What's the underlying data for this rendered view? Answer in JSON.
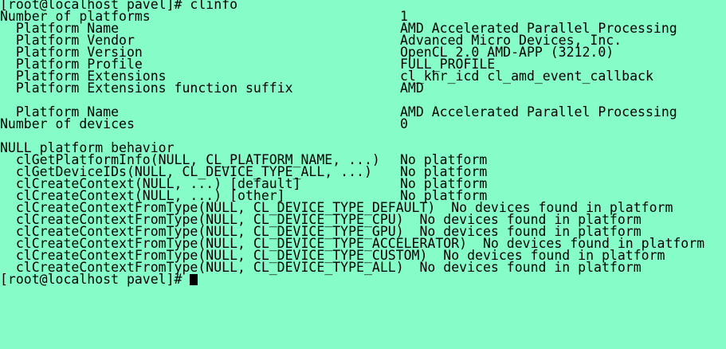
{
  "terminal": {
    "prompt": "[root@localhost pavel]# clinfo",
    "num_platforms": {
      "label": "Number of platforms",
      "value": "1"
    },
    "platform_name": {
      "label": "  Platform Name",
      "value": "AMD Accelerated Parallel Processing"
    },
    "platform_vendor": {
      "label": "  Platform Vendor",
      "value": "Advanced Micro Devices, Inc."
    },
    "platform_version": {
      "label": "  Platform Version",
      "value": "OpenCL 2.0 AMD-APP (3212.0)"
    },
    "platform_profile": {
      "label": "  Platform Profile",
      "value": "FULL_PROFILE"
    },
    "platform_extensions": {
      "label": "  Platform Extensions",
      "value": "cl_khr_icd cl_amd_event_callback"
    },
    "platform_ext_suffix": {
      "label": "  Platform Extensions function suffix",
      "value": "AMD"
    },
    "platform_name_2": {
      "label": "  Platform Name",
      "value": "AMD Accelerated Parallel Processing"
    },
    "num_devices": {
      "label": "Number of devices",
      "value": "0"
    },
    "null_behavior_header": "NULL platform behavior",
    "null_rows": [
      {
        "label": "  clGetPlatformInfo(NULL, CL_PLATFORM_NAME, ...)",
        "value": "No platform"
      },
      {
        "label": "  clGetDeviceIDs(NULL, CL_DEVICE_TYPE_ALL, ...)",
        "value": "No platform"
      },
      {
        "label": "  clCreateContext(NULL, ...) [default]",
        "value": "No platform"
      },
      {
        "label": "  clCreateContext(NULL, ...) [other]",
        "value": "No platform"
      }
    ],
    "ctx_from_type": [
      "  clCreateContextFromType(NULL, CL_DEVICE_TYPE_DEFAULT)  No devices found in platform",
      "  clCreateContextFromType(NULL, CL_DEVICE_TYPE_CPU)  No devices found in platform",
      "  clCreateContextFromType(NULL, CL_DEVICE_TYPE_GPU)  No devices found in platform",
      "  clCreateContextFromType(NULL, CL_DEVICE_TYPE_ACCELERATOR)  No devices found in platform",
      "  clCreateContextFromType(NULL, CL_DEVICE_TYPE_CUSTOM)  No devices found in platform",
      "  clCreateContextFromType(NULL, CL_DEVICE_TYPE_ALL)  No devices found in platform"
    ],
    "final_prompt": "[root@localhost pavel]# "
  }
}
